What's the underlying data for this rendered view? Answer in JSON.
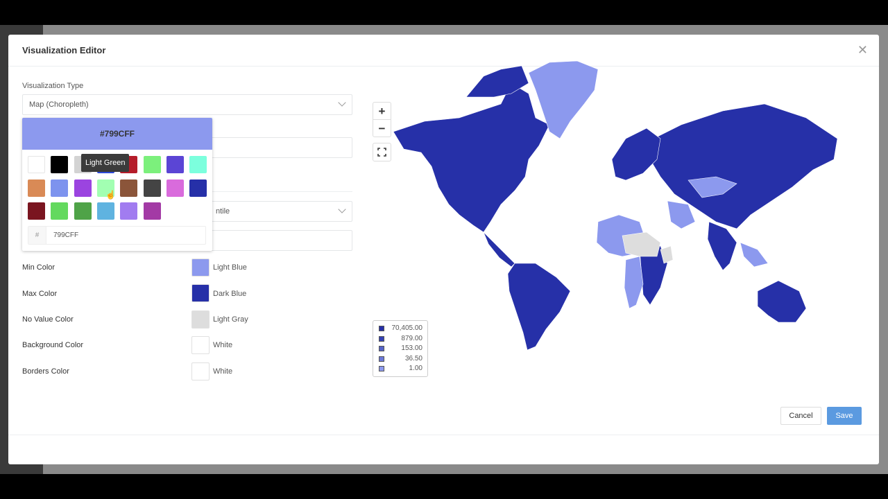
{
  "modal": {
    "title": "Visualization Editor",
    "close_glyph": "✕"
  },
  "form": {
    "viz_type_label": "Visualization Type",
    "viz_type_value": "Map (Choropleth)",
    "hidden_select_value_partial": "ntile"
  },
  "picker": {
    "hex_display": "#799CFF",
    "hash_glyph": "#",
    "hex_input_value": "799CFF",
    "tooltip": "Light Green",
    "palette": [
      "#ffffff",
      "#000000",
      "#d3d3d3",
      "#2d4ad9",
      "#b51d2a",
      "#7cf07c",
      "#5b45d5",
      "#7cffdd",
      "#d98a56",
      "#7d93ee",
      "#9b44e0",
      "#a2ffb2",
      "#8b553a",
      "#444444",
      "#d96bdc",
      "#2630a8",
      "#7a1520",
      "#63d95e",
      "#4fa348",
      "#5fb3e0",
      "#a17cf0",
      "#a33aa5"
    ]
  },
  "colors": {
    "min_label": "Min Color",
    "min_name": "Light Blue",
    "min_hex": "#8c99ee",
    "max_label": "Max Color",
    "max_name": "Dark Blue",
    "max_hex": "#2630a8",
    "novalue_label": "No Value Color",
    "novalue_name": "Light Gray",
    "novalue_hex": "#dddddd",
    "bg_label": "Background Color",
    "bg_name": "White",
    "bg_hex": "#ffffff",
    "border_label": "Borders Color",
    "border_name": "White",
    "border_hex": "#ffffff"
  },
  "map": {
    "zoom_in": "+",
    "zoom_out": "−",
    "legend": [
      {
        "value": "70,405.00",
        "color": "#2630a8"
      },
      {
        "value": "879.00",
        "color": "#3442b5"
      },
      {
        "value": "153.00",
        "color": "#5563c8"
      },
      {
        "value": "36.50",
        "color": "#6b78d8"
      },
      {
        "value": "1.00",
        "color": "#8c99ee"
      }
    ]
  },
  "footer": {
    "cancel_label": "Cancel",
    "save_label": "Save"
  }
}
